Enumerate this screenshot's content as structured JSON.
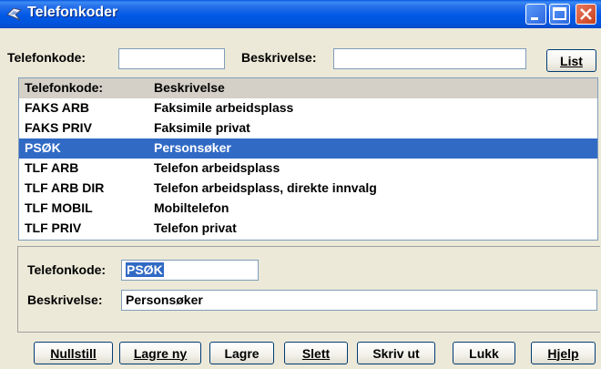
{
  "window": {
    "title": "Telefonkoder",
    "icon": "app-bird-icon",
    "title_gradient": "#0058e6"
  },
  "search": {
    "code_label": "Telefonkode:",
    "code_value": "",
    "desc_label": "Beskrivelse:",
    "desc_value": "",
    "list_button": "List"
  },
  "list": {
    "headers": [
      "Telefonkode:",
      "Beskrivelse"
    ],
    "rows": [
      {
        "code": "FAKS ARB",
        "desc": "Faksimile arbeidsplass",
        "selected": false
      },
      {
        "code": "FAKS PRIV",
        "desc": "Faksimile privat",
        "selected": false
      },
      {
        "code": "PSØK",
        "desc": "Personsøker",
        "selected": true
      },
      {
        "code": "TLF ARB",
        "desc": "Telefon arbeidsplass",
        "selected": false
      },
      {
        "code": "TLF ARB DIR",
        "desc": "Telefon arbeidsplass, direkte innvalg",
        "selected": false
      },
      {
        "code": "TLF MOBIL",
        "desc": "Mobiltelefon",
        "selected": false
      },
      {
        "code": "TLF PRIV",
        "desc": "Telefon privat",
        "selected": false
      }
    ],
    "selected_color": "#316ac5"
  },
  "detail": {
    "code_label": "Telefonkode:",
    "code_value": "PSØK",
    "desc_label": "Beskrivelse:",
    "desc_value": "Personsøker"
  },
  "buttons": {
    "reset": "Nullstill",
    "save_new": "Lagre ny",
    "save": "Lagre",
    "delete": "Slett",
    "print": "Skriv ut",
    "close": "Lukk",
    "help": "Hjelp"
  }
}
